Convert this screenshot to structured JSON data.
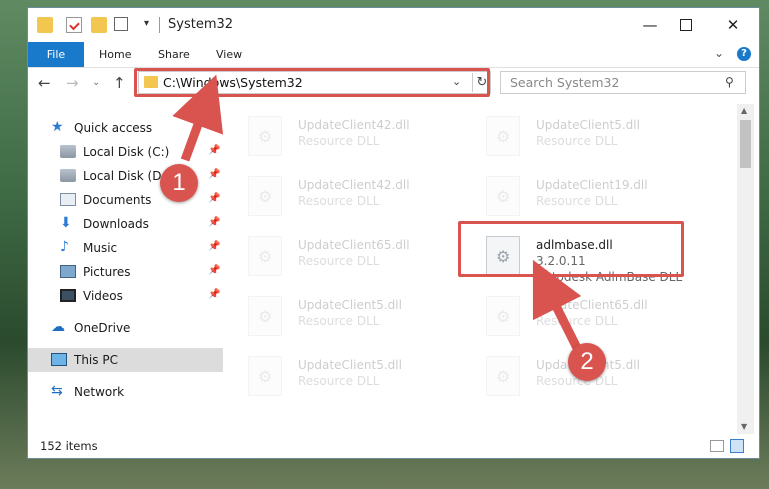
{
  "window": {
    "title": "System32",
    "minimize_label": "—",
    "maximize_label": "",
    "close_label": "✕"
  },
  "quick_access_toolbar": {
    "dropdown_glyph": "▾"
  },
  "ribbon": {
    "tabs": [
      "File",
      "Home",
      "Share",
      "View"
    ],
    "expand_glyph": "⌄",
    "help_glyph": "?"
  },
  "nav": {
    "back_glyph": "←",
    "forward_glyph": "→",
    "recent_glyph": "⌄",
    "up_glyph": "↑",
    "address": "C:\\Windows\\System32",
    "address_dropdown_glyph": "⌄",
    "refresh_glyph": "↻",
    "search_placeholder": "Search System32",
    "search_glyph": "⚲"
  },
  "sidebar": {
    "items": [
      {
        "label": "Quick access",
        "icon": "star-icon",
        "pinned": false
      },
      {
        "label": "Local Disk (C:)",
        "icon": "drive-icon",
        "pinned": true
      },
      {
        "label": "Local Disk (D:)",
        "icon": "drive-icon",
        "pinned": true
      },
      {
        "label": "Documents",
        "icon": "documents-icon",
        "pinned": true
      },
      {
        "label": "Downloads",
        "icon": "download-icon",
        "pinned": true
      },
      {
        "label": "Music",
        "icon": "music-icon",
        "pinned": true
      },
      {
        "label": "Pictures",
        "icon": "pictures-icon",
        "pinned": true
      },
      {
        "label": "Videos",
        "icon": "videos-icon",
        "pinned": true
      },
      {
        "label": "OneDrive",
        "icon": "cloud-icon",
        "pinned": false
      },
      {
        "label": "This PC",
        "icon": "pc-icon",
        "pinned": false,
        "selected": true
      },
      {
        "label": "Network",
        "icon": "network-icon",
        "pinned": false
      }
    ],
    "pin_glyph": "📌"
  },
  "files": [
    {
      "name": "UpdateClient42.dll",
      "type": "Resource DLL"
    },
    {
      "name": "UpdateClient5.dll",
      "type": "Resource DLL"
    },
    {
      "name": "UpdateClient42.dll",
      "type": "Resource DLL"
    },
    {
      "name": "UpdateClient19.dll",
      "type": "Resource DLL"
    },
    {
      "name": "UpdateClient65.dll",
      "type": "Resource DLL"
    },
    {
      "name": "adlmbase.dll",
      "version": "3.2.0.11",
      "description": "Autodesk AdlmBase DLL",
      "highlighted": true
    },
    {
      "name": "UpdateClient5.dll",
      "type": "Resource DLL"
    },
    {
      "name": "UpdateClient65.dll",
      "type": "Resource DLL"
    },
    {
      "name": "UpdateClient5.dll",
      "type": "Resource DLL"
    },
    {
      "name": "UpdateClient5.dll",
      "type": "Resource DLL"
    }
  ],
  "status": {
    "item_count": "152 items"
  },
  "callouts": {
    "step1": "1",
    "step2": "2"
  },
  "colors": {
    "accent": "#1979ca",
    "callout": "#d9534f"
  }
}
